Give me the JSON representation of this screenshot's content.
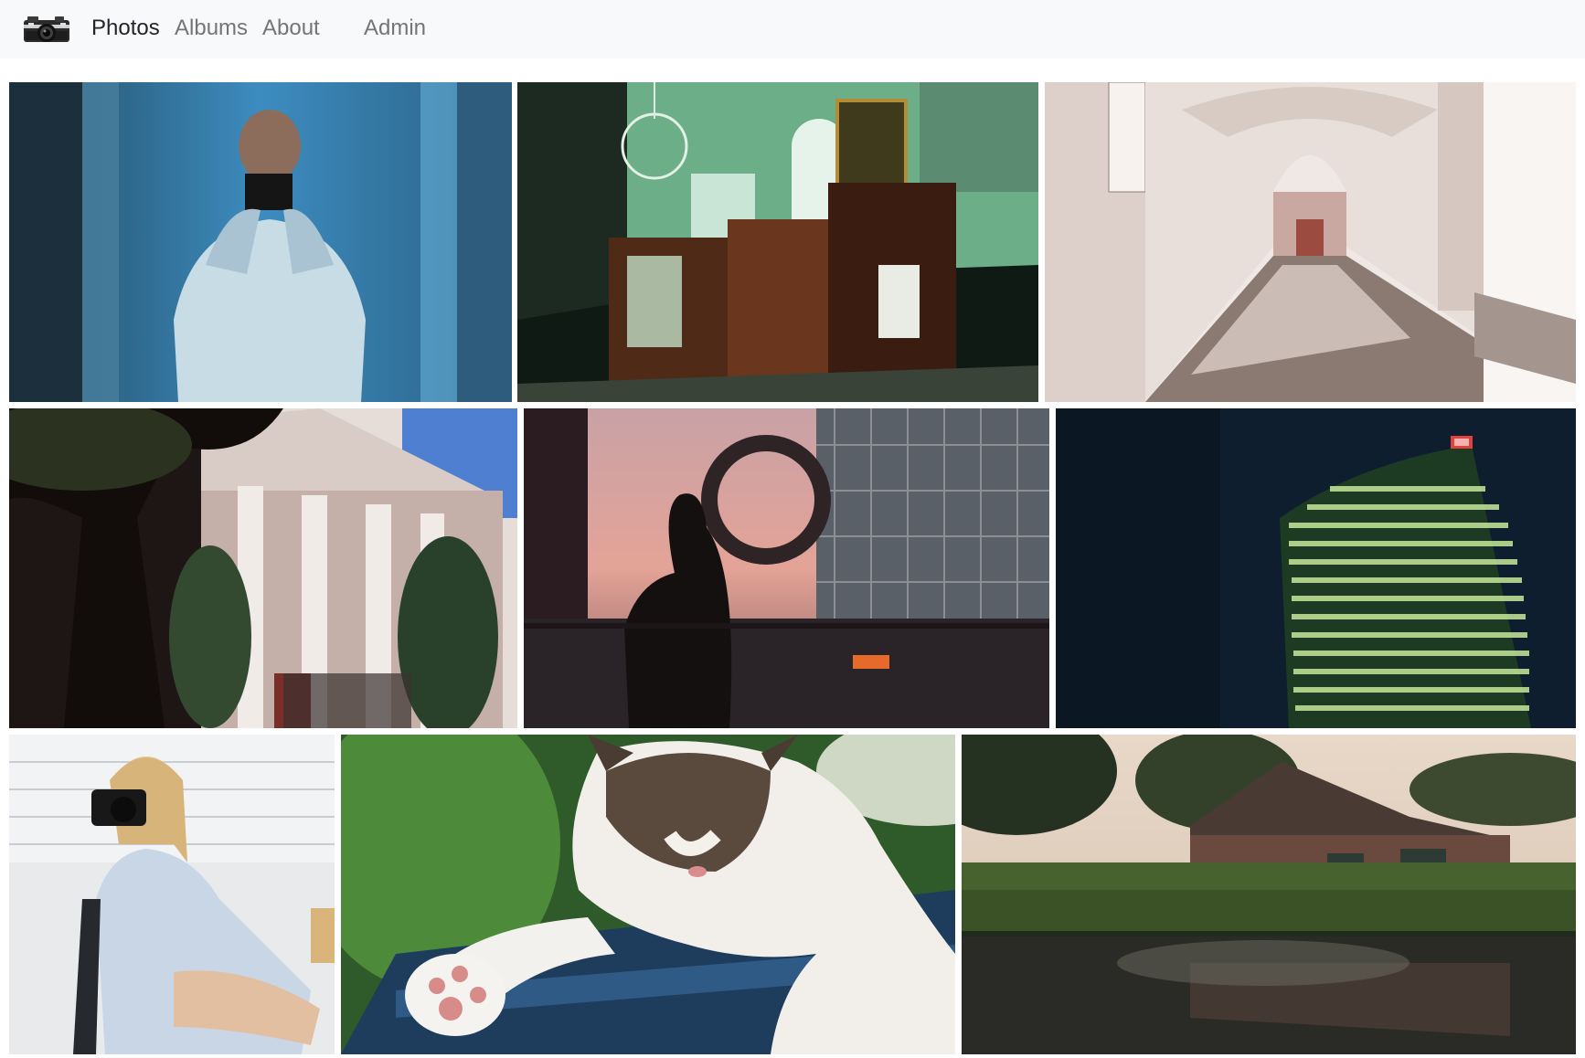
{
  "navbar": {
    "brand_icon": "vintage-camera-logo-icon",
    "links": [
      {
        "label": "Photos",
        "active": true
      },
      {
        "label": "Albums",
        "active": false
      },
      {
        "label": "About",
        "active": false
      },
      {
        "label": "Admin",
        "active": false
      }
    ]
  },
  "gallery": {
    "rows": [
      [
        {
          "subject": "man-taking-mirror-selfie-blue-wall"
        },
        {
          "subject": "green-church-interior-with-chandelier"
        },
        {
          "subject": "arched-white-colonnade-walkway"
        }
      ],
      [
        {
          "subject": "classical-building-with-columns-and-tree"
        },
        {
          "subject": "silhouette-at-glass-window-with-wreath"
        },
        {
          "subject": "db-tower-at-night"
        }
      ],
      [
        {
          "subject": "woman-holding-camera-in-chair"
        },
        {
          "subject": "sleeping-cat-on-bench"
        },
        {
          "subject": "brick-barn-by-pond-at-dusk"
        }
      ]
    ]
  },
  "colors": {
    "navbar_bg": "#f8f9fa",
    "nav_active": "#212529",
    "nav_inactive": "#757575"
  }
}
